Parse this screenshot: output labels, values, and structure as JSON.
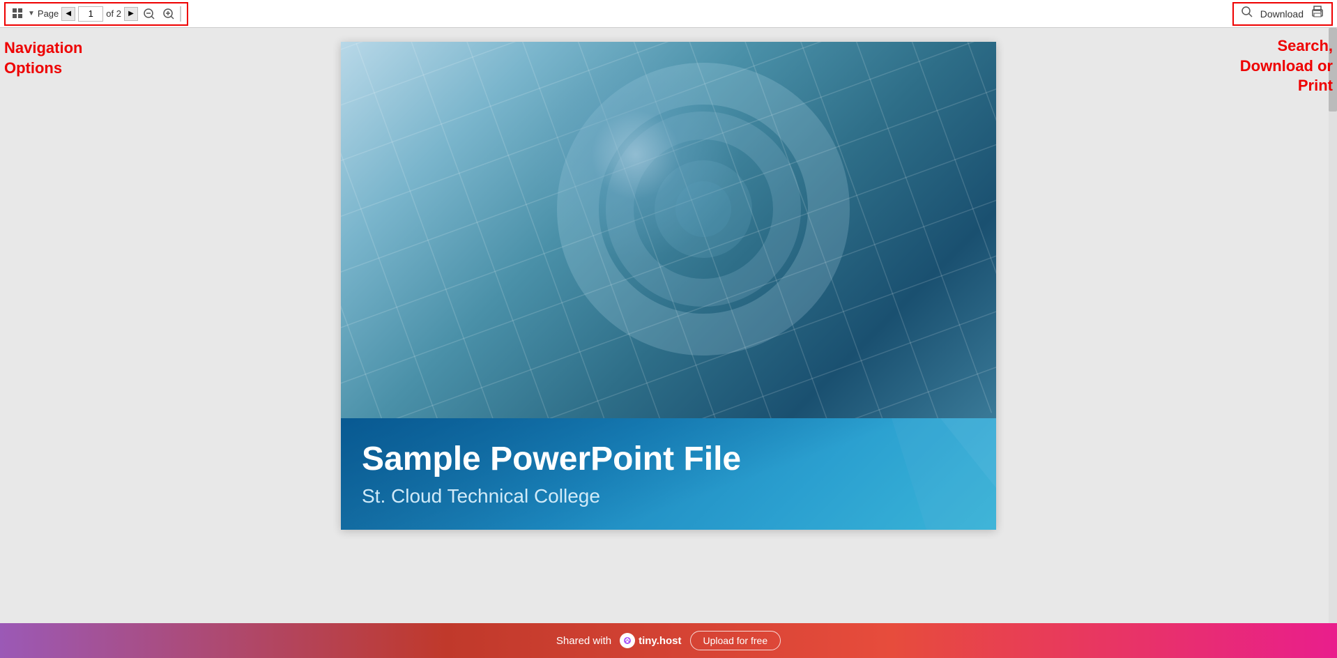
{
  "toolbar": {
    "page_label": "Page",
    "current_page": "1",
    "total_pages": "of 2",
    "zoom_in_label": "+",
    "zoom_out_label": "−",
    "download_label": "Download",
    "nav_annotation": "Navigation\nOptions",
    "search_annotation": "Search,\nDownload or\nPrint"
  },
  "slide": {
    "title": "Sample PowerPoint File",
    "subtitle": "St. Cloud Technical College"
  },
  "bottom_banner": {
    "shared_text": "Shared with",
    "brand_name": "tiny.host",
    "upload_label": "Upload for free"
  },
  "colors": {
    "annotation_red": "#e00000",
    "toolbar_border": "#cc0000",
    "slide_bg_top": "#7ab5cc",
    "slide_bg_bottom": "#1e8ac0",
    "banner_start": "#9b59b6",
    "banner_end": "#e91e8c"
  },
  "icons": {
    "grid": "grid-icon",
    "prev": "◀",
    "next": "▶",
    "zoom_in": "zoom-in-icon",
    "zoom_out": "zoom-out-icon",
    "separator": "separator-icon",
    "search": "🔍",
    "print": "🖨"
  }
}
